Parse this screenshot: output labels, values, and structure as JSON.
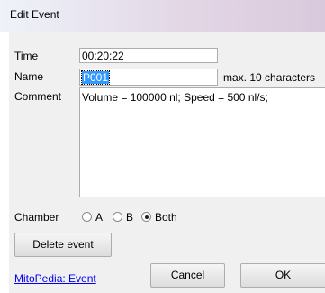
{
  "window": {
    "title": "Edit Event"
  },
  "form": {
    "time_label": "Time",
    "time_value": "00:20:22",
    "name_label": "Name",
    "name_value": "P001",
    "name_hint": "max. 10 characters",
    "comment_label": "Comment",
    "comment_value": "Volume =  100000 nl; Speed =   500 nl/s;",
    "chamber_label": "Chamber",
    "chamber_options": [
      {
        "label": "A",
        "checked": false
      },
      {
        "label": "B",
        "checked": false
      },
      {
        "label": "Both",
        "checked": true
      }
    ]
  },
  "buttons": {
    "delete": "Delete event",
    "cancel": "Cancel",
    "ok": "OK"
  },
  "link": {
    "help": "MitoPedia: Event"
  }
}
